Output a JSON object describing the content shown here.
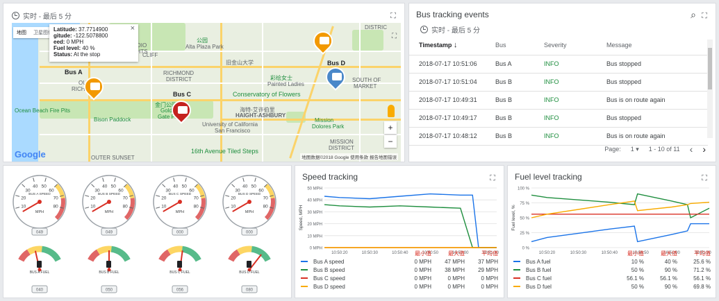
{
  "time_range": "实时 - 最后 5 分",
  "expand_icon": "⛶",
  "map": {
    "map_type": [
      "地图",
      "卫星图像"
    ],
    "info": {
      "lat_label": "Latitude:",
      "lat": "37.7714900",
      "lon_label": "gitude:",
      "lon": "-122.5078800",
      "speed_label": "eed:",
      "speed": "0 MPH",
      "fuel_label": "Fuel level:",
      "fuel": "40 %",
      "status_label": "Status:",
      "status": "At the stop",
      "close": "×"
    },
    "buses": [
      "Bus A",
      "Bus C",
      "Bus D"
    ],
    "labels": [
      "PRESIDIO",
      "HEIGHTS",
      "Alta Plaza Park",
      "公园",
      "CLIFF",
      "RICHMOND",
      "DISTRICT",
      "OUTER",
      "RICHMOND",
      "旧金山大学",
      "彩绘女士",
      "Painted Ladies",
      "Conservatory of Flowers",
      "SOUTH OF",
      "MARKET",
      "金门公园",
      "Golden",
      "Gate Park",
      "Ocean Beach Fire Pits",
      "Bison Paddock",
      "海特-艾许伯里",
      "HAIGHT-ASHBURY",
      "University of California",
      "San Francisco",
      "Mission",
      "Dolores Park",
      "MISSION",
      "DISTRICT",
      "16th Avenue Tiled Steps",
      "OUTER SUNSET",
      "DISTRIC"
    ],
    "zoom_in": "+",
    "zoom_out": "−",
    "google": "Google",
    "copyright": "地图数据©2018 Google   使用条款   报告地图错误"
  },
  "events": {
    "title": "Bus tracking events",
    "columns": [
      "Timestamp",
      "Bus",
      "Severity",
      "Message"
    ],
    "sort_icon": "↓",
    "rows": [
      [
        "2018-07-17 10:51:06",
        "Bus A",
        "INFO",
        "Bus stopped"
      ],
      [
        "2018-07-17 10:51:04",
        "Bus B",
        "INFO",
        "Bus stopped"
      ],
      [
        "2018-07-17 10:49:31",
        "Bus B",
        "INFO",
        "Bus is on route again"
      ],
      [
        "2018-07-17 10:49:17",
        "Bus B",
        "INFO",
        "Bus stopped"
      ],
      [
        "2018-07-17 10:48:12",
        "Bus B",
        "INFO",
        "Bus is on route again"
      ]
    ],
    "page_label": "Page:",
    "page_value": "1",
    "range": "1 - 10 of 11",
    "prev": "‹",
    "next": "›",
    "search_icon": "⌕"
  },
  "gauges": {
    "speed": [
      {
        "label": "BUS A SPEED",
        "odo": "049"
      },
      {
        "label": "BUS B SPEED",
        "odo": "049"
      },
      {
        "label": "BUS C SPEED",
        "odo": "000"
      },
      {
        "label": "BUS D SPEED",
        "odo": "000"
      }
    ],
    "ticks": [
      "10",
      "20",
      "30",
      "40",
      "50",
      "60",
      "70",
      "80"
    ],
    "unit": "MPH",
    "fuel": [
      {
        "label": "BUS A FUEL",
        "odo": "040",
        "level": 0.4
      },
      {
        "label": "BUS B FUEL",
        "odo": "050",
        "level": 0.5
      },
      {
        "label": "BUS C FUEL",
        "odo": "056",
        "level": 0.56
      },
      {
        "label": "BUS D FUEL",
        "odo": "080",
        "level": 0.8
      }
    ]
  },
  "speed_chart": {
    "title": "Speed tracking",
    "legend_headers": [
      "最小值",
      "最大值",
      "平均值"
    ],
    "legend": [
      {
        "name": "Bus A speed",
        "min": "0 MPH",
        "max": "47 MPH",
        "avg": "37 MPH"
      },
      {
        "name": "Bus B speed",
        "min": "0 MPH",
        "max": "38 MPH",
        "avg": "29 MPH"
      },
      {
        "name": "Bus C speed",
        "min": "0 MPH",
        "max": "0 MPH",
        "avg": "0 MPH"
      },
      {
        "name": "Bus D speed",
        "min": "0 MPH",
        "max": "0 MPH",
        "avg": "0 MPH"
      }
    ]
  },
  "fuel_chart": {
    "title": "Fuel level tracking",
    "legend_headers": [
      "最小值",
      "最大值",
      "平均值"
    ],
    "legend": [
      {
        "name": "Bus A fuel",
        "min": "10 %",
        "max": "40 %",
        "avg": "25.6 %"
      },
      {
        "name": "Bus B fuel",
        "min": "50 %",
        "max": "90 %",
        "avg": "71.2 %"
      },
      {
        "name": "Bus C fuel",
        "min": "56.1 %",
        "max": "56.1 %",
        "avg": "56.1 %"
      },
      {
        "name": "Bus D fuel",
        "min": "50 %",
        "max": "90 %",
        "avg": "69.8 %"
      }
    ]
  },
  "colors": {
    "bus_a": "#1a73e8",
    "bus_b": "#1e8e3e",
    "bus_c": "#d93025",
    "bus_d": "#f9ab00",
    "marker_a": "#f29900",
    "marker_c": "#c5221f",
    "marker_d": "#4a88c9"
  },
  "chart_data": [
    {
      "type": "line",
      "title": "Speed tracking",
      "xlabel": "",
      "ylabel": "Speed, MPH",
      "x_ticks": [
        "10:50:20",
        "10:50:30",
        "10:50:40",
        "10:50:50",
        "10:51:00",
        "10:51:10"
      ],
      "y_ticks": [
        "0 MPH",
        "10 MPH",
        "20 MPH",
        "30 MPH",
        "40 MPH",
        "50 MPH"
      ],
      "ylim": [
        0,
        50
      ],
      "x": [
        "10:50:15",
        "10:50:20",
        "10:50:30",
        "10:50:40",
        "10:50:50",
        "10:51:00",
        "10:51:04",
        "10:51:06",
        "10:51:12"
      ],
      "series": [
        {
          "name": "Bus A speed",
          "values": [
            43,
            42,
            41,
            43,
            45,
            44,
            44,
            0,
            0
          ]
        },
        {
          "name": "Bus B speed",
          "values": [
            36,
            35,
            34,
            35,
            34,
            33,
            0,
            0,
            0
          ]
        },
        {
          "name": "Bus C speed",
          "values": [
            0,
            0,
            0,
            0,
            0,
            0,
            0,
            0,
            0
          ]
        },
        {
          "name": "Bus D speed",
          "values": [
            0,
            0,
            0,
            0,
            0,
            0,
            0,
            0,
            0
          ]
        }
      ]
    },
    {
      "type": "line",
      "title": "Fuel level tracking",
      "xlabel": "",
      "ylabel": "Fuel level, %",
      "x_ticks": [
        "10:50:20",
        "10:50:30",
        "10:50:40",
        "10:50:50",
        "10:51:00",
        "10:51:10"
      ],
      "y_ticks": [
        "0 %",
        "25 %",
        "50 %",
        "75 %",
        "100 %"
      ],
      "ylim": [
        0,
        100
      ],
      "x": [
        "10:50:15",
        "10:50:20",
        "10:50:30",
        "10:50:40",
        "10:50:48",
        "10:50:49",
        "10:51:00",
        "10:51:05",
        "10:51:06",
        "10:51:12"
      ],
      "series": [
        {
          "name": "Bus A fuel",
          "values": [
            10,
            17,
            24,
            31,
            36,
            10,
            22,
            28,
            40,
            40
          ]
        },
        {
          "name": "Bus B fuel",
          "values": [
            88,
            84,
            80,
            76,
            72,
            90,
            78,
            72,
            50,
            66
          ]
        },
        {
          "name": "Bus C fuel",
          "values": [
            56.1,
            56.1,
            56.1,
            56.1,
            56.1,
            56.1,
            56.1,
            56.1,
            56.1,
            56.1
          ]
        },
        {
          "name": "Bus D fuel",
          "values": [
            50,
            56,
            64,
            72,
            78,
            62,
            68,
            72,
            74,
            76
          ]
        }
      ]
    }
  ]
}
